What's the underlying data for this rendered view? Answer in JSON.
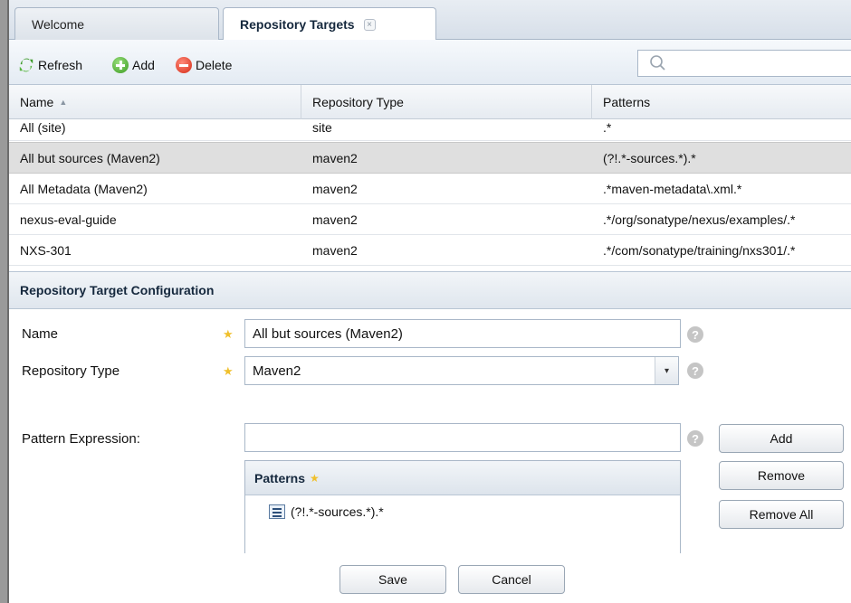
{
  "tabs": [
    {
      "label": "Welcome"
    },
    {
      "label": "Repository Targets",
      "close": "×"
    }
  ],
  "toolbar": {
    "refresh_label": "Refresh",
    "add_label": "Add",
    "delete_label": "Delete",
    "search_value": ""
  },
  "grid": {
    "columns": [
      "Name",
      "Repository Type",
      "Patterns"
    ],
    "sort_indicator": "▲",
    "rows": [
      {
        "name": "All (site)",
        "type": "site",
        "patterns": ".*"
      },
      {
        "name": "All but sources (Maven2)",
        "type": "maven2",
        "patterns": "(?!.*-sources.*).*"
      },
      {
        "name": "All Metadata (Maven2)",
        "type": "maven2",
        "patterns": ".*maven-metadata\\.xml.*"
      },
      {
        "name": "nexus-eval-guide",
        "type": "maven2",
        "patterns": ".*/org/sonatype/nexus/examples/.*"
      },
      {
        "name": "NXS-301",
        "type": "maven2",
        "patterns": ".*/com/sonatype/training/nxs301/.*"
      }
    ],
    "selected_index": 1
  },
  "config": {
    "title": "Repository Target Configuration",
    "name_label": "Name",
    "name_value": "All but sources (Maven2)",
    "type_label": "Repository Type",
    "type_value": "Maven2",
    "pattern_expr_label": "Pattern Expression:",
    "pattern_expr_value": "",
    "required_star": "★",
    "help_symbol": "?",
    "combo_arrow": "▾",
    "patterns_title": "Patterns",
    "patterns_list": [
      "(?!.*-sources.*).*"
    ],
    "add_btn": "Add",
    "remove_btn": "Remove",
    "remove_all_btn": "Remove All",
    "save_btn": "Save",
    "cancel_btn": "Cancel"
  },
  "colors": {
    "selected_row": "#dfdfdf",
    "star": "#f0c02c",
    "header_text": "#15283d"
  }
}
